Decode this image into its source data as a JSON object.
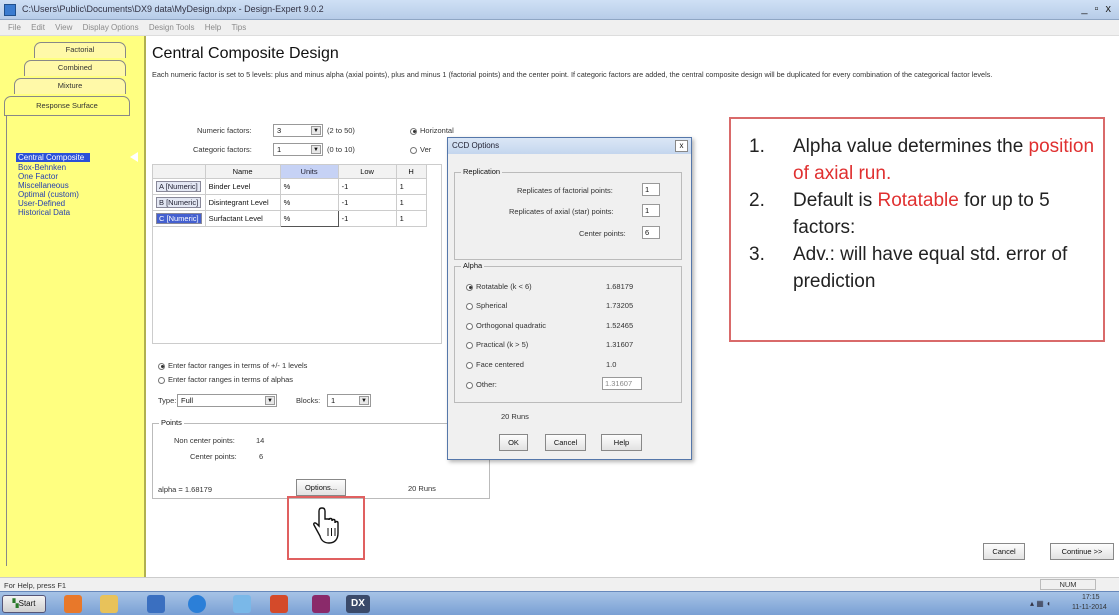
{
  "window": {
    "title": "C:\\Users\\Public\\Documents\\DX9 data\\MyDesign.dxpx - Design-Expert 9.0.2",
    "controls": "_ ▫ x"
  },
  "menu": [
    "File",
    "Edit",
    "View",
    "Display Options",
    "Design Tools",
    "Help",
    "Tips"
  ],
  "left_tabs": [
    "Factorial",
    "Combined",
    "Mixture",
    "Response Surface"
  ],
  "left_nav": [
    "Central Composite",
    "Box-Behnken",
    "One Factor",
    "Miscellaneous",
    "Optimal (custom)",
    "User-Defined",
    "Historical Data"
  ],
  "main": {
    "title": "Central Composite Design",
    "description": "Each numeric factor is set to 5 levels: plus and minus alpha (axial points), plus and minus 1 (factorial points) and the center point. If categoric factors are added, the central composite design will be duplicated for every combination of the categorical factor levels.",
    "numeric_factors_label": "Numeric factors:",
    "numeric_factors_value": "3",
    "numeric_factors_range": "(2 to 50)",
    "categoric_factors_label": "Categoric factors:",
    "categoric_factors_value": "1",
    "categoric_factors_range": "(0 to 10)",
    "orientation_horizontal": "Horizontal",
    "orientation_vertical": "Ver",
    "table_headers": [
      "Name",
      "Units",
      "Low",
      "H"
    ],
    "table_rows": [
      {
        "factor": "A [Numeric]",
        "name": "Binder Level",
        "units": "%",
        "low": "-1",
        "high": "1"
      },
      {
        "factor": "B [Numeric]",
        "name": "Disintegrant Level",
        "units": "%",
        "low": "-1",
        "high": "1"
      },
      {
        "factor": "C [Numeric]",
        "name": "Surfactant Level",
        "units": "%",
        "low": "-1",
        "high": "1"
      }
    ],
    "range_option_1": "Enter factor ranges in terms of +/- 1 levels",
    "range_option_2": "Enter factor ranges in terms of alphas",
    "type_label": "Type:",
    "type_value": "Full",
    "blocks_label": "Blocks:",
    "blocks_value": "1",
    "points_group": "Points",
    "non_center_label": "Non center points:",
    "non_center_value": "14",
    "center_label": "Center points:",
    "center_value": "6",
    "alpha_text": "alpha = 1.68179",
    "options_button": "Options...",
    "runs_text": "20 Runs",
    "cancel_button": "Cancel",
    "continue_button": "Continue >>"
  },
  "dialog": {
    "title": "CCD Options",
    "close": "x",
    "replication_group": "Replication",
    "rep_factorial_label": "Replicates of factorial points:",
    "rep_factorial_value": "1",
    "rep_axial_label": "Replicates of axial (star) points:",
    "rep_axial_value": "1",
    "center_points_label": "Center points:",
    "center_points_value": "6",
    "alpha_group": "Alpha",
    "alpha_options": [
      {
        "label": "Rotatable (k < 6)",
        "value": "1.68179"
      },
      {
        "label": "Spherical",
        "value": "1.73205"
      },
      {
        "label": "Orthogonal quadratic",
        "value": "1.52465"
      },
      {
        "label": "Practical (k > 5)",
        "value": "1.31607"
      },
      {
        "label": "Face centered",
        "value": "1.0"
      },
      {
        "label": "Other:",
        "value": "1.31607"
      }
    ],
    "runs_text": "20 Runs",
    "ok_button": "OK",
    "cancel_button": "Cancel",
    "help_button": "Help"
  },
  "annotation": {
    "items": [
      {
        "num": "1.",
        "pre": "Alpha value determines the ",
        "red": "position of axial run.",
        "post": ""
      },
      {
        "num": "2.",
        "pre": "Default is ",
        "red": "Rotatable",
        "post": " for up to 5 factors:"
      },
      {
        "num": "3.",
        "pre": "Adv.: will have equal std. error of prediction",
        "red": "",
        "post": ""
      }
    ]
  },
  "status": {
    "help": "For Help, press F1",
    "num": "NUM"
  },
  "taskbar": {
    "start": "Start",
    "clock_time": "17:15",
    "clock_date": "11-11-2014",
    "dx_label": "DX"
  },
  "colors": {
    "left_panel": "#ffff80",
    "annotation_border": "#d96a6a",
    "annotation_red": "#e03030",
    "selected_nav": "#2a50d8"
  }
}
